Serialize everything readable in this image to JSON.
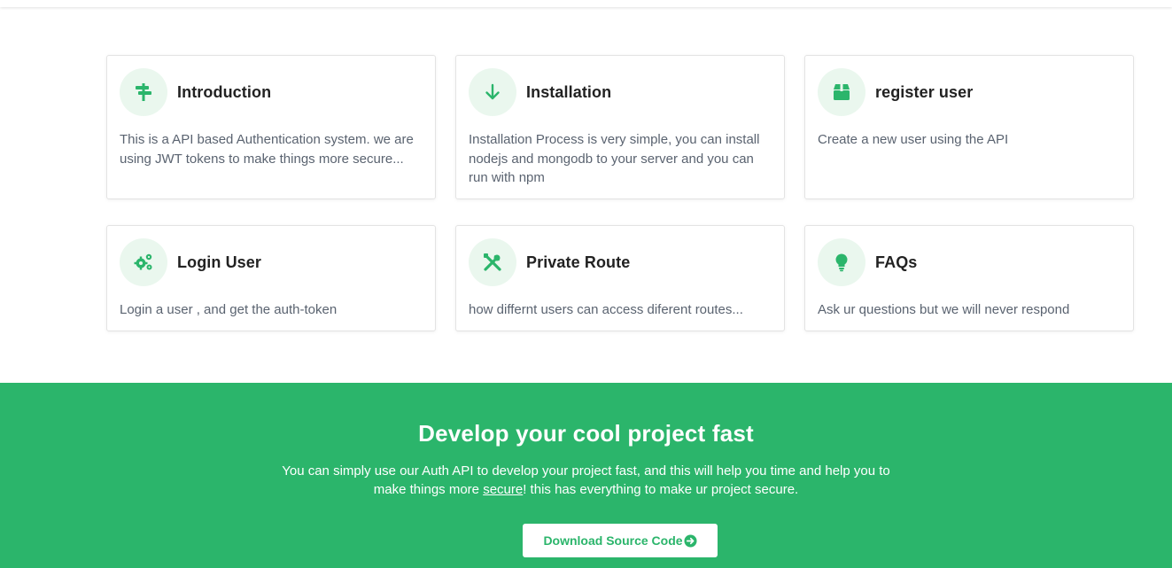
{
  "accent_color": "#2bb56b",
  "cards": [
    {
      "title": "Introduction",
      "icon": "signpost-icon",
      "desc": "This is a API based Authentication system. we are using JWT tokens to make things more secure..."
    },
    {
      "title": "Installation",
      "icon": "arrow-down-icon",
      "desc": "Installation Process is very simple, you can install nodejs and mongodb to your server and you can run with npm"
    },
    {
      "title": "register user",
      "icon": "box-icon",
      "desc": "Create a new user using the API"
    },
    {
      "title": "Login User",
      "icon": "gears-icon",
      "desc": "Login a user , and get the auth-token"
    },
    {
      "title": "Private Route",
      "icon": "tools-icon",
      "desc": "how differnt users can access diferent routes..."
    },
    {
      "title": "FAQs",
      "icon": "lightbulb-icon",
      "desc": "Ask ur questions but we will never respond"
    }
  ],
  "banner": {
    "title": "Develop your cool project fast",
    "text_before": "You can simply use our Auth API to develop your project fast, and this will help you time and help you to make things more ",
    "text_link": "secure",
    "text_after": "! this has everything to make ur project secure.",
    "button_label": "Download Source Code",
    "button_icon": "arrow-circle-right-icon"
  }
}
